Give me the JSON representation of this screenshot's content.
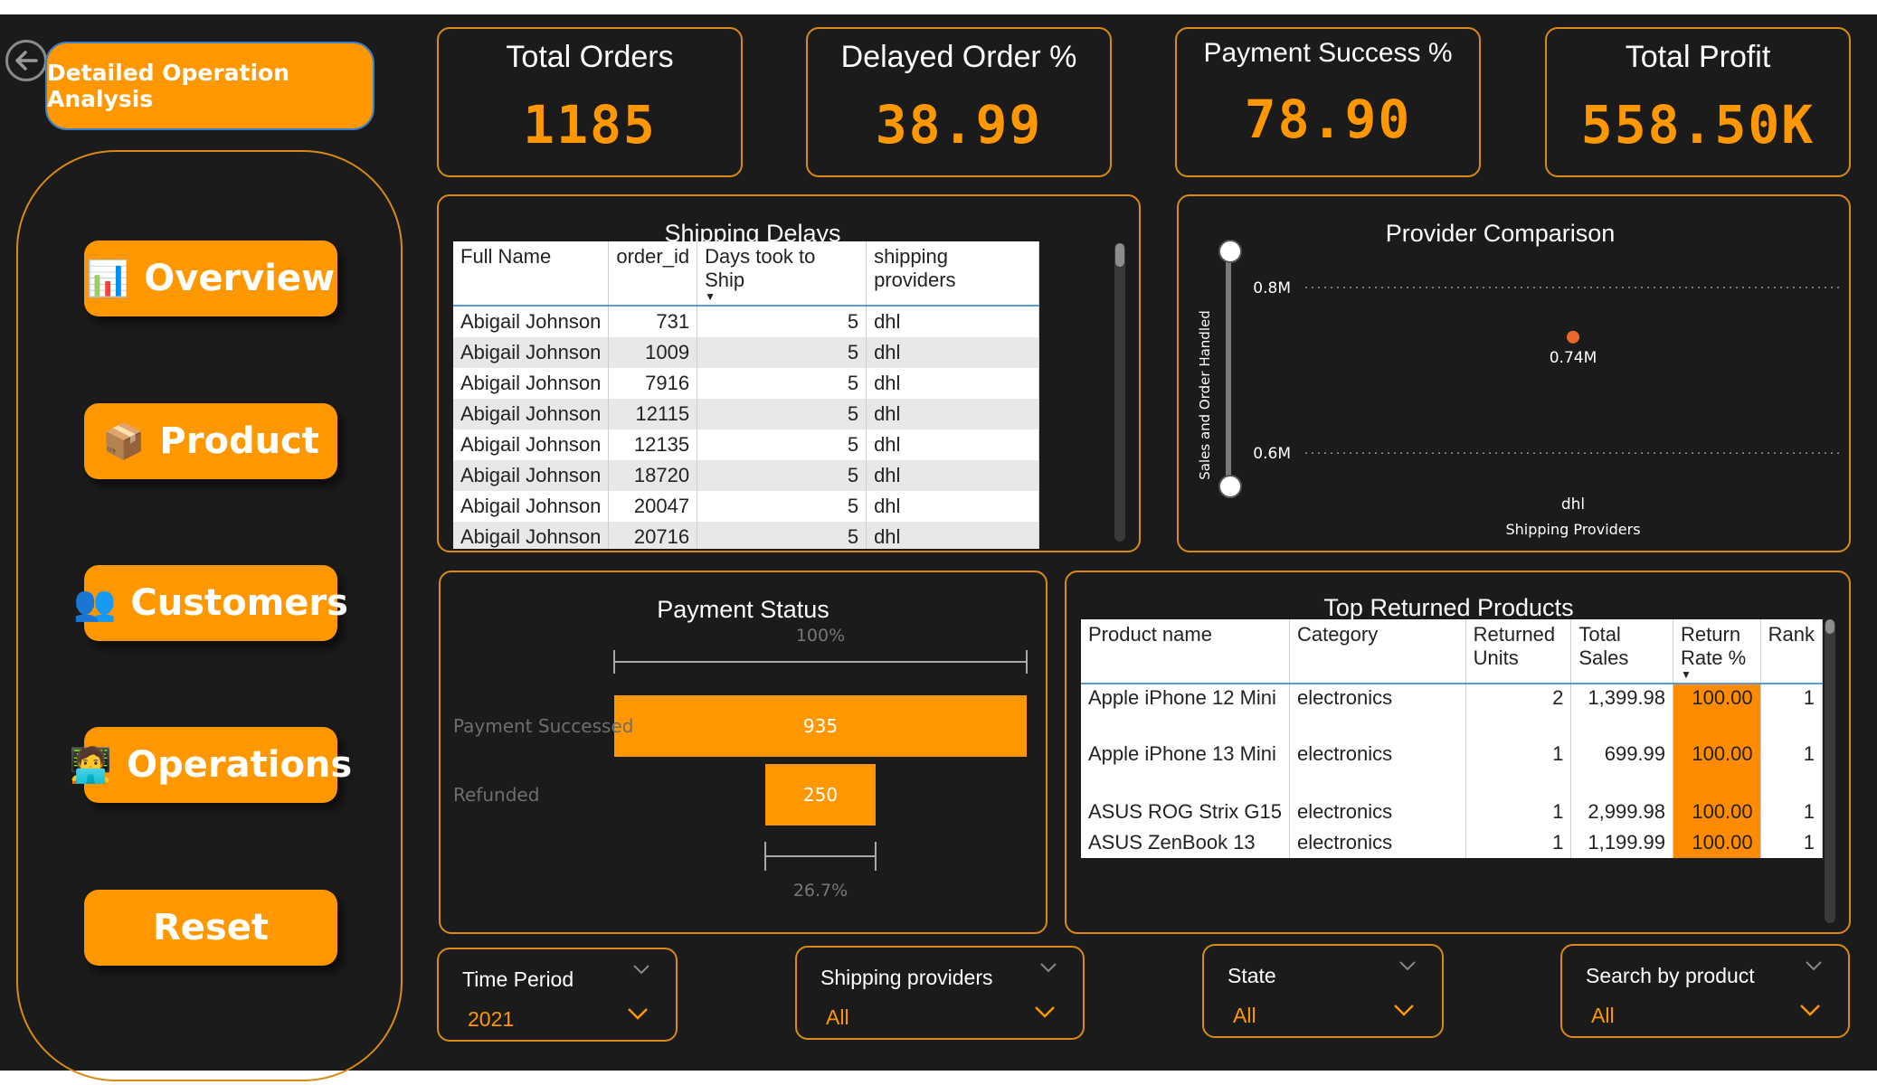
{
  "header": {
    "title": "Detailed Operation Analysis"
  },
  "nav": [
    {
      "label": "Overview",
      "icon": "📊",
      "icon_name": "bar-chart-icon"
    },
    {
      "label": "Product",
      "icon": "📦",
      "icon_name": "package-icon"
    },
    {
      "label": "Customers",
      "icon": "👥",
      "icon_name": "people-icon"
    },
    {
      "label": "Operations",
      "icon": "🧑‍💻",
      "icon_name": "operator-icon"
    },
    {
      "label": "Reset",
      "icon": "",
      "icon_name": ""
    }
  ],
  "kpis": {
    "total_orders": {
      "label": "Total Orders",
      "value": "1185"
    },
    "delayed_order": {
      "label": "Delayed Order %",
      "value": "38.99"
    },
    "payment_success": {
      "label": "Payment Success %",
      "value": "78.90"
    },
    "total_profit": {
      "label": "Total Profit",
      "value": "558.50K"
    }
  },
  "shipping_delays": {
    "title": "Shipping Delays",
    "columns": [
      "Full Name",
      "order_id",
      "Days took to Ship",
      "shipping providers"
    ],
    "rows": [
      [
        "Abigail Johnson",
        "731",
        "5",
        "dhl"
      ],
      [
        "Abigail Johnson",
        "1009",
        "5",
        "dhl"
      ],
      [
        "Abigail Johnson",
        "7916",
        "5",
        "dhl"
      ],
      [
        "Abigail Johnson",
        "12115",
        "5",
        "dhl"
      ],
      [
        "Abigail Johnson",
        "12135",
        "5",
        "dhl"
      ],
      [
        "Abigail Johnson",
        "18720",
        "5",
        "dhl"
      ],
      [
        "Abigail Johnson",
        "20047",
        "5",
        "dhl"
      ],
      [
        "Abigail Johnson",
        "20716",
        "5",
        "dhl"
      ]
    ]
  },
  "provider_comparison": {
    "title": "Provider Comparison",
    "chart_data": {
      "type": "scatter",
      "title": "Provider Comparison",
      "xlabel": "Shipping Providers",
      "ylabel": "Sales and Order Handled",
      "categories": [
        "dhl"
      ],
      "values": [
        0.74
      ],
      "data_labels": [
        "0.74M"
      ],
      "y_ticks": [
        "0.8M",
        "0.6M"
      ],
      "y_tick_values": [
        0.8,
        0.6
      ],
      "ylim": [
        0.55,
        0.85
      ],
      "grid": true,
      "color": "#e8692a"
    }
  },
  "payment_status": {
    "title": "Payment Status",
    "chart_data": {
      "type": "bar",
      "title": "Payment Status",
      "categories": [
        "Payment Successed",
        "Refunded"
      ],
      "values": [
        935,
        250
      ],
      "top_label": "100%",
      "bottom_label": "26.7%",
      "color": "#ff9800"
    }
  },
  "top_returned": {
    "title": "Top Returned Products",
    "columns": [
      "Product name",
      "Category",
      "Returned Units",
      "Total Sales",
      "Return Rate %",
      "Rank"
    ],
    "rows": [
      [
        "Apple iPhone 12 Mini",
        "electronics",
        "2",
        "1,399.98",
        "100.00",
        "1"
      ],
      [
        "Apple iPhone 13 Mini",
        "electronics",
        "1",
        "699.99",
        "100.00",
        "1"
      ],
      [
        "ASUS ROG Strix G15",
        "electronics",
        "1",
        "2,999.98",
        "100.00",
        "1"
      ],
      [
        "ASUS ZenBook 13",
        "electronics",
        "1",
        "1,199.99",
        "100.00",
        "1"
      ]
    ]
  },
  "slicers": [
    {
      "label": "Time Period",
      "value": "2021"
    },
    {
      "label": "Shipping providers",
      "value": "All"
    },
    {
      "label": "State",
      "value": "All"
    },
    {
      "label": "Search by product",
      "value": "All"
    }
  ],
  "colors": {
    "accent": "#ff9800",
    "background": "#1b1b1b",
    "border": "#d88a14"
  }
}
